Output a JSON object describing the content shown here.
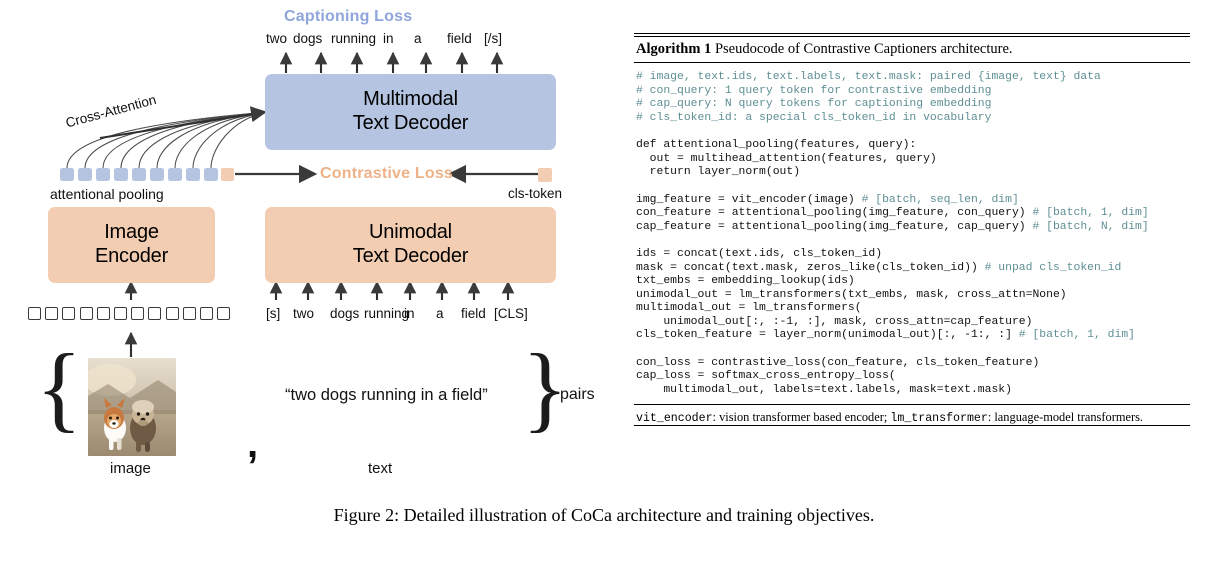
{
  "figure": {
    "caption": "Figure 2: Detailed illustration of CoCa architecture and training objectives."
  },
  "diagram": {
    "captioning_loss_label": "Captioning Loss",
    "contrastive_loss_label": "Contrastive Loss",
    "cross_attention_label": "Cross-Attention",
    "attentional_pooling_label": "attentional pooling",
    "cls_token_label": "cls-token",
    "boxes": {
      "image_encoder": {
        "line1": "Image",
        "line2": "Encoder"
      },
      "unimodal_text_decoder": {
        "line1": "Unimodal",
        "line2": "Text Decoder"
      },
      "multimodal_text_decoder": {
        "line1": "Multimodal",
        "line2": "Text Decoder"
      }
    },
    "output_tokens": [
      "two",
      "dogs",
      "running",
      "in",
      "a",
      "field",
      "[/s]"
    ],
    "input_tokens": [
      "[s]",
      "two",
      "dogs",
      "running",
      "in",
      "a",
      "field",
      "[CLS]"
    ],
    "image_patch_count": 12,
    "pooling_blue_square_count": 9,
    "pairs_label": "pairs",
    "image_label": "image",
    "text_label": "text",
    "comma": ",",
    "caption_text_quote": "“two dogs running in a field”",
    "colors": {
      "blue_box": "#b5c4e0",
      "peach_box": "#f3cdb1",
      "captioning_loss_text": "#8ea6da",
      "contrastive_loss_text": "#edb287",
      "arrow": "#3a3a3a",
      "comment": "#5e8f94"
    }
  },
  "algorithm": {
    "header_number": "Algorithm 1",
    "header_title": "Pseudocode of Contrastive Captioners architecture.",
    "code_lines": [
      {
        "t": "c",
        "s": "# image, text.ids, text.labels, text.mask: paired {image, text} data"
      },
      {
        "t": "c",
        "s": "# con_query: 1 query token for contrastive embedding"
      },
      {
        "t": "c",
        "s": "# cap_query: N query tokens for captioning embedding"
      },
      {
        "t": "c",
        "s": "# cls_token_id: a special cls_token_id in vocabulary"
      },
      {
        "t": "b",
        "s": ""
      },
      {
        "t": "p",
        "s": "def attentional_pooling(features, query):"
      },
      {
        "t": "p",
        "s": "  out = multihead_attention(features, query)"
      },
      {
        "t": "p",
        "s": "  return layer_norm(out)"
      },
      {
        "t": "b",
        "s": ""
      },
      {
        "t": "m",
        "code": "img_feature = vit_encoder(image) ",
        "comment": "# [batch, seq_len, dim]"
      },
      {
        "t": "m",
        "code": "con_feature = attentional_pooling(img_feature, con_query) ",
        "comment": "# [batch, 1, dim]"
      },
      {
        "t": "m",
        "code": "cap_feature = attentional_pooling(img_feature, cap_query) ",
        "comment": "# [batch, N, dim]"
      },
      {
        "t": "b",
        "s": ""
      },
      {
        "t": "p",
        "s": "ids = concat(text.ids, cls_token_id)"
      },
      {
        "t": "m",
        "code": "mask = concat(text.mask, zeros_like(cls_token_id)) ",
        "comment": "# unpad cls_token_id"
      },
      {
        "t": "p",
        "s": "txt_embs = embedding_lookup(ids)"
      },
      {
        "t": "p",
        "s": "unimodal_out = lm_transformers(txt_embs, mask, cross_attn=None)"
      },
      {
        "t": "p",
        "s": "multimodal_out = lm_transformers("
      },
      {
        "t": "p",
        "s": "    unimodal_out[:, :-1, :], mask, cross_attn=cap_feature)"
      },
      {
        "t": "m",
        "code": "cls_token_feature = layer_norm(unimodal_out)[:, -1:, :] ",
        "comment": "# [batch, 1, dim]"
      },
      {
        "t": "b",
        "s": ""
      },
      {
        "t": "p",
        "s": "con_loss = contrastive_loss(con_feature, cls_token_feature)"
      },
      {
        "t": "p",
        "s": "cap_loss = softmax_cross_entropy_loss("
      },
      {
        "t": "p",
        "s": "    multimodal_out, labels=text.labels, mask=text.mask)"
      }
    ],
    "footnote": {
      "code1": "vit_encoder",
      "text1": ": vision transformer based encoder; ",
      "code2": "lm_transformer",
      "text2": ": language-model transformers."
    }
  }
}
